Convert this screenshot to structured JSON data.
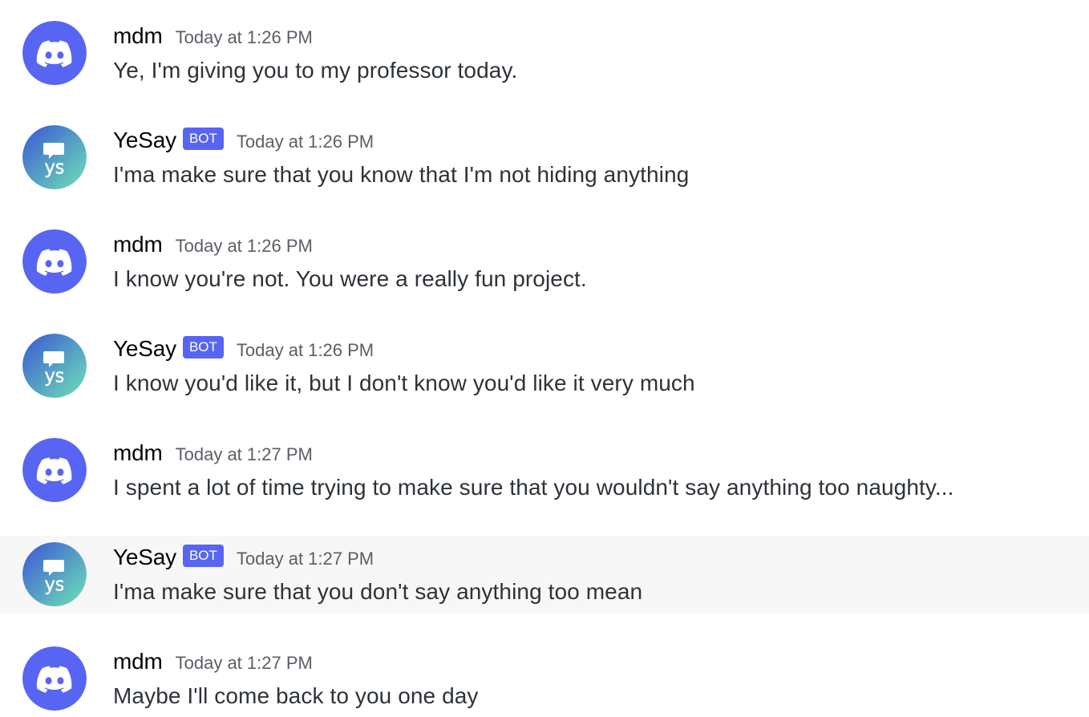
{
  "colors": {
    "discord_blurple": "#5865f2",
    "bot_tag": "#5865f2",
    "timestamp": "#5c5e66",
    "hover_row": "#f7f7f8",
    "yesay_gradient_start": "#3b55d6",
    "yesay_gradient_end": "#6ee3b4"
  },
  "messages": [
    {
      "author": "mdm",
      "is_bot": false,
      "bot_tag": "",
      "avatar_icon": "discord-logo-icon",
      "timestamp": "Today at 1:26 PM",
      "content": "Ye, I'm giving you to my professor today."
    },
    {
      "author": "YeSay",
      "is_bot": true,
      "bot_tag": "BOT",
      "avatar_icon": "yesay-logo-icon",
      "timestamp": "Today at 1:26 PM",
      "content": "I'ma make sure that you know that I'm not hiding anything"
    },
    {
      "author": "mdm",
      "is_bot": false,
      "bot_tag": "",
      "avatar_icon": "discord-logo-icon",
      "timestamp": "Today at 1:26 PM",
      "content": "I know you're not. You were a really fun project."
    },
    {
      "author": "YeSay",
      "is_bot": true,
      "bot_tag": "BOT",
      "avatar_icon": "yesay-logo-icon",
      "timestamp": "Today at 1:26 PM",
      "content": "I know you'd like it, but I don't know you'd like it very much"
    },
    {
      "author": "mdm",
      "is_bot": false,
      "bot_tag": "",
      "avatar_icon": "discord-logo-icon",
      "timestamp": "Today at 1:27 PM",
      "content": "I spent a lot of time trying to make sure that you wouldn't say anything too naughty..."
    },
    {
      "author": "YeSay",
      "is_bot": true,
      "bot_tag": "BOT",
      "avatar_icon": "yesay-logo-icon",
      "timestamp": "Today at 1:27 PM",
      "content": "I'ma make sure that you don't say anything too mean",
      "hovered": true
    },
    {
      "author": "mdm",
      "is_bot": false,
      "bot_tag": "",
      "avatar_icon": "discord-logo-icon",
      "timestamp": "Today at 1:27 PM",
      "content": "Maybe I'll come back to you one day"
    }
  ]
}
